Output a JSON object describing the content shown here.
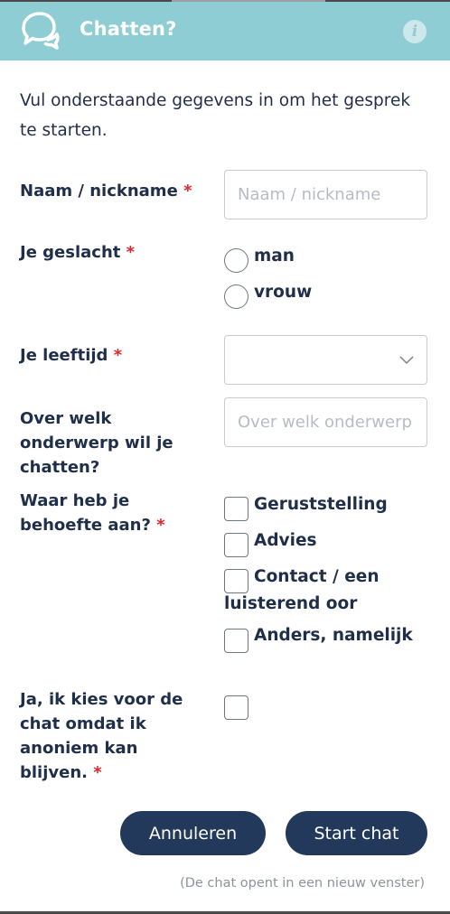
{
  "header": {
    "title": "Chatten?",
    "icon": "chat-bubbles-icon",
    "info_icon": "info-icon",
    "info_glyph": "i",
    "background_color": "#8ecdd3"
  },
  "intro": "Vul onderstaande gegevens in om het gesprek te starten.",
  "required_mark": "*",
  "fields": {
    "name": {
      "label": "Naam / nickname",
      "placeholder": "Naam / nickname",
      "value": ""
    },
    "gender": {
      "label": "Je geslacht",
      "options": [
        "man",
        "vrouw"
      ]
    },
    "age": {
      "label": "Je leeftijd",
      "selected": ""
    },
    "topic": {
      "label": "Over welk onderwerp wil je chatten?",
      "placeholder": "Over welk onderwerp wil je chatten?",
      "value": ""
    },
    "need": {
      "label": "Waar heb je behoefte aan?",
      "options": [
        "Geruststelling",
        "Advies",
        "Contact / een luisterend oor",
        "Anders, namelijk"
      ]
    },
    "anonymous": {
      "label": "Ja, ik kies voor de chat omdat ik anoniem kan blijven."
    }
  },
  "buttons": {
    "cancel": "Annuleren",
    "start": "Start chat"
  },
  "footnote": "(De chat opent in een nieuw venster)",
  "colors": {
    "button": "#23395b",
    "required": "#e0252d",
    "text": "#1f2f4a"
  }
}
